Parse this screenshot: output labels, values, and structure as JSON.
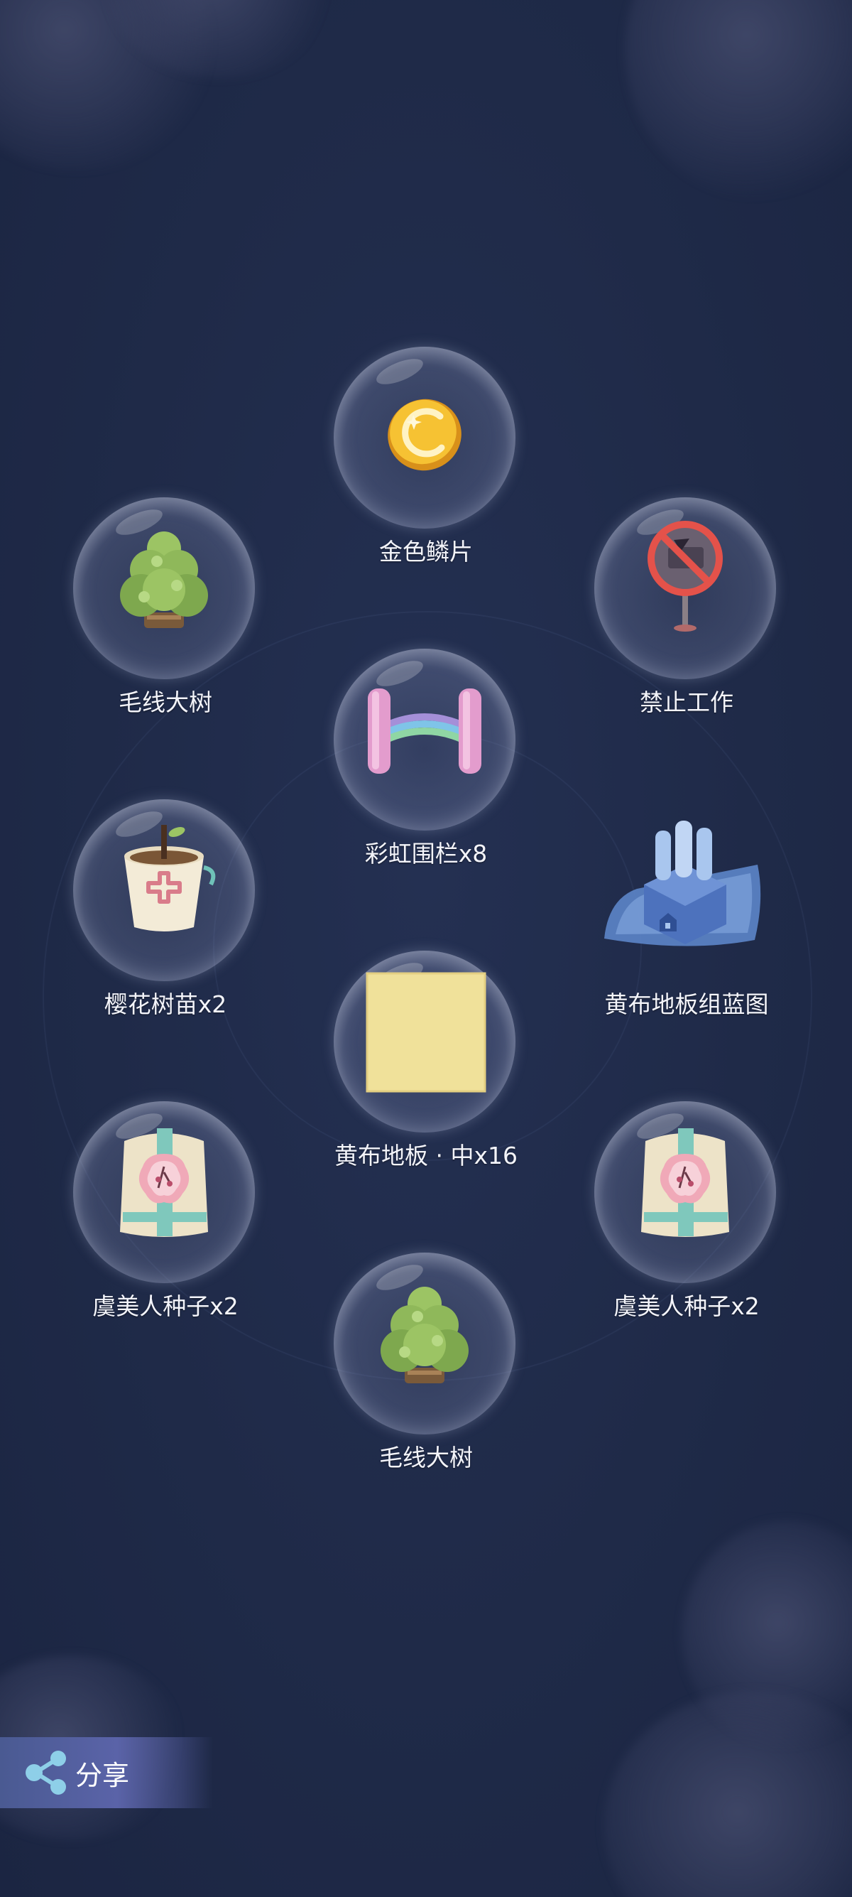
{
  "rewards": [
    {
      "name": "金色鳞片",
      "icon": "golden-scale-icon"
    },
    {
      "name": "毛线大树",
      "icon": "yarn-tree-icon"
    },
    {
      "name": "禁止工作",
      "icon": "no-work-sign-icon"
    },
    {
      "name": "彩虹围栏x8",
      "icon": "rainbow-fence-icon"
    },
    {
      "name": "樱花树苗x2",
      "icon": "sakura-sapling-icon"
    },
    {
      "name": "黄布地板组蓝图",
      "icon": "blueprint-icon"
    },
    {
      "name": "黄布地板 · 中x16",
      "icon": "yellow-floor-tile-icon"
    },
    {
      "name": "虞美人种子x2",
      "icon": "poppy-seed-bag-icon"
    },
    {
      "name": "虞美人种子x2",
      "icon": "poppy-seed-bag-icon"
    },
    {
      "name": "毛线大树",
      "icon": "yarn-tree-icon"
    }
  ],
  "share": {
    "label": "分享",
    "icon": "share-icon"
  },
  "colors": {
    "background": "#1f2a48",
    "label": "#f3f4fa",
    "share_button": "#5a63a8",
    "tree_green": "#8fb85a",
    "gold": "#f3b927",
    "floor_tile": "#f0e19a"
  }
}
